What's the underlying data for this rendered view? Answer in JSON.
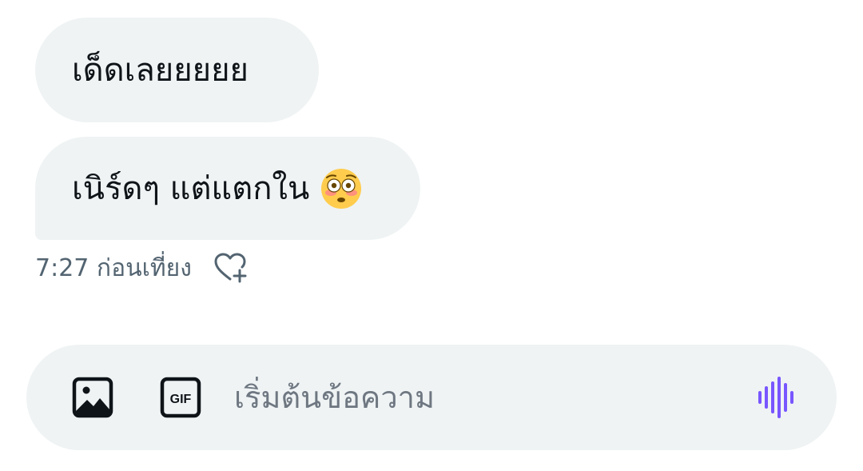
{
  "messages": [
    {
      "text": "เด็ดเลยยยยย"
    },
    {
      "text": "เนิร์ดๆ แต่แตกใน",
      "emoji": "flushed-face"
    }
  ],
  "meta": {
    "timestamp": "7:27 ก่อนเที่ยง",
    "reaction_icon": "heart-plus-icon"
  },
  "composer": {
    "placeholder": "เริ่มต้นข้อความ",
    "value": "",
    "icons": [
      "image-icon",
      "gif-icon",
      "voice-waveform-icon"
    ],
    "accent_color": "#7856ff"
  },
  "colors": {
    "bubble_bg": "#eff3f4",
    "text": "#0f1419",
    "secondary_text": "#536471"
  }
}
